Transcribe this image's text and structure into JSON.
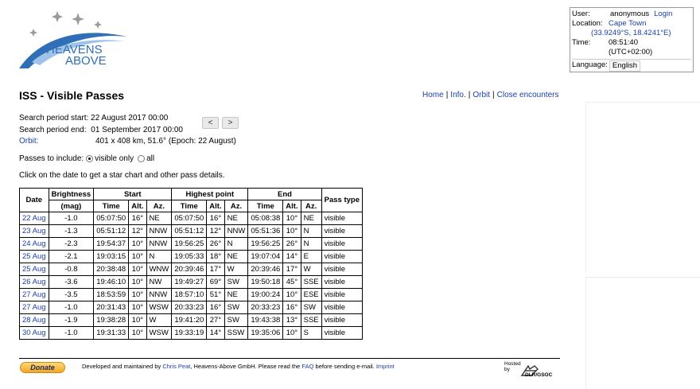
{
  "logo": {
    "line1": "HEAVENS",
    "line2": "ABOVE"
  },
  "user": {
    "user_label": "User:",
    "user_value": "anonymous",
    "login_link": "Login",
    "location_label": "Location:",
    "location_value": "Cape Town",
    "coords": "(33.9249°S, 18.4241°E)",
    "time_label": "Time:",
    "time_value": "08:51:40",
    "tz": "(UTC+02:00)",
    "language_label": "Language:",
    "language_value": "English"
  },
  "title": "ISS - Visible Passes",
  "nav_links": {
    "home": "Home",
    "info": "Info.",
    "orbit": "Orbit",
    "close": "Close encounters"
  },
  "search": {
    "start_label": "Search period start:",
    "start_value": "22 August 2017 00:00",
    "end_label": "Search period end:",
    "end_value": "01 September 2017 00:00",
    "orbit_label": "Orbit:",
    "orbit_value": "401 x 408 km, 51.6° (Epoch: 22 August)",
    "prev": "<",
    "next": ">"
  },
  "passes_filter": {
    "label": "Passes to include:",
    "opt1": "visible only",
    "opt2": "all",
    "selected": "visible only"
  },
  "hint": "Click on the date to get a star chart and other pass details.",
  "table": {
    "headers": {
      "date": "Date",
      "brightness": "Brightness",
      "mag": "(mag)",
      "start": "Start",
      "highest": "Highest point",
      "end": "End",
      "pass_type": "Pass type",
      "time": "Time",
      "alt": "Alt.",
      "az": "Az."
    },
    "rows": [
      [
        "22 Aug",
        "-1.0",
        "05:07:50",
        "16°",
        "NE",
        "05:07:50",
        "16°",
        "NE",
        "05:08:38",
        "10°",
        "NE",
        "visible"
      ],
      [
        "23 Aug",
        "-1.3",
        "05:51:12",
        "12°",
        "NNW",
        "05:51:12",
        "12°",
        "NNW",
        "05:51:36",
        "10°",
        "N",
        "visible"
      ],
      [
        "24 Aug",
        "-2.3",
        "19:54:37",
        "10°",
        "NNW",
        "19:56:25",
        "26°",
        "N",
        "19:56:25",
        "26°",
        "N",
        "visible"
      ],
      [
        "25 Aug",
        "-2.1",
        "19:03:15",
        "10°",
        "N",
        "19:05:33",
        "18°",
        "NE",
        "19:07:04",
        "14°",
        "E",
        "visible"
      ],
      [
        "25 Aug",
        "-0.8",
        "20:38:48",
        "10°",
        "WNW",
        "20:39:46",
        "17°",
        "W",
        "20:39:46",
        "17°",
        "W",
        "visible"
      ],
      [
        "26 Aug",
        "-3.6",
        "19:46:10",
        "10°",
        "NW",
        "19:49:27",
        "69°",
        "SW",
        "19:50:18",
        "45°",
        "SSE",
        "visible"
      ],
      [
        "27 Aug",
        "-3.5",
        "18:53:59",
        "10°",
        "NNW",
        "18:57:10",
        "51°",
        "NE",
        "19:00:24",
        "10°",
        "ESE",
        "visible"
      ],
      [
        "27 Aug",
        "-1.0",
        "20:31:43",
        "10°",
        "WSW",
        "20:33:23",
        "16°",
        "SW",
        "20:33:23",
        "16°",
        "SW",
        "visible"
      ],
      [
        "28 Aug",
        "-1.9",
        "19:38:28",
        "10°",
        "W",
        "19:41:20",
        "27°",
        "SW",
        "19:43:38",
        "13°",
        "SSE",
        "visible"
      ],
      [
        "30 Aug",
        "-1.0",
        "19:31:33",
        "10°",
        "WSW",
        "19:33:19",
        "14°",
        "SSW",
        "19:35:06",
        "10°",
        "S",
        "visible"
      ]
    ]
  },
  "footer": {
    "donate": "Donate",
    "text_pre": "Developed and maintained by ",
    "author": "Chris Peat",
    "text_mid": ", Heavens-Above GmbH. Please read the ",
    "faq": "FAQ",
    "text_post": " before sending e-mail. ",
    "imprint": "Imprint",
    "hosted_by": "Hosted\nby",
    "host": "DLR/GSOC"
  },
  "colors": {
    "link": "#1a3fa8",
    "logo": "#2f6fb5"
  }
}
